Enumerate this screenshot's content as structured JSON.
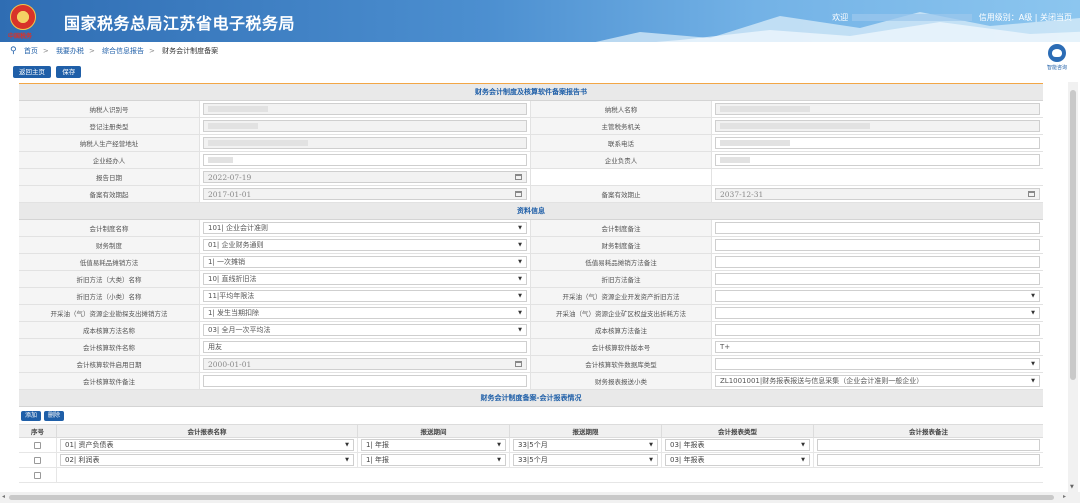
{
  "header": {
    "emblem_text": "中国税务",
    "title": "国家税务总局江苏省电子税务局",
    "welcome": "欢迎",
    "credit": "信用级别：A级",
    "close": "关闭当页"
  },
  "breadcrumb": {
    "items": [
      "首页",
      "我要办税",
      "综合信息报告",
      "财务会计制度备案"
    ]
  },
  "toolbar": {
    "back": "返回主页",
    "save": "保存"
  },
  "assistant": {
    "label": "智能咨询"
  },
  "sections": {
    "main": "财务会计制度及核算软件备案报告书",
    "info": "资料信息",
    "report": "财务会计制度备案-会计报表情况"
  },
  "basic": {
    "taxpayer_id_label": "纳税人识别号",
    "taxpayer_name_label": "纳税人名称",
    "reg_type_label": "登记注册类型",
    "tax_office_label": "主管税务机关",
    "address_label": "纳税人生产经营地址",
    "phone_label": "联系电话",
    "agent_label": "企业经办人",
    "responsible_label": "企业负责人",
    "report_date_label": "报告日期",
    "report_date": "2022-07-19",
    "valid_from_label": "备案有效期起",
    "valid_from": "2017-01-01",
    "valid_to_label": "备案有效期止",
    "valid_to": "2037-12-31"
  },
  "info": {
    "acct_system_name_label": "会计制度名称",
    "acct_system_name": "101| 企业会计准则",
    "acct_system_note_label": "会计制度备注",
    "fin_system_label": "财务制度",
    "fin_system": "01| 企业财务通则",
    "fin_system_note_label": "财务制度备注",
    "low_value_label": "低值易耗品摊销方法",
    "low_value": "1| 一次摊销",
    "low_value_note_label": "低值易耗品摊销方法备注",
    "dep_big_label": "折旧方法（大类）名称",
    "dep_big": "10| 直线折旧法",
    "dep_note_label": "折旧方法备注",
    "dep_small_label": "折旧方法（小类）名称",
    "dep_small": "11|平均年限法",
    "oil_dev_label": "开采油（气）资源企业开发资产折旧方法",
    "oil_exp_label": "开采油（气）资源企业勘探支出摊销方法",
    "oil_exp": "1| 发生当期扣除",
    "oil_mine_label": "开采油（气）资源企业矿区权益支出折耗方法",
    "cost_label": "成本核算方法名称",
    "cost": "03| 全月一次平均法",
    "cost_note_label": "成本核算方法备注",
    "soft_name_label": "会计核算软件名称",
    "soft_name": "用友",
    "soft_ver_label": "会计核算软件版本号",
    "soft_ver": "T+",
    "soft_date_label": "会计核算软件启用日期",
    "soft_date": "2000-01-01",
    "soft_db_label": "会计核算软件数据库类型",
    "soft_note_label": "会计核算软件备注",
    "fin_report_label": "财务报表报送小类",
    "fin_report": "ZL1001001|财务报表报送与信息采集（企业会计准则一般企业）"
  },
  "grid": {
    "add": "添加",
    "del": "删除",
    "headers": [
      "序号",
      "会计报表名称",
      "报送期间",
      "报送期限",
      "会计报表类型",
      "会计报表备注"
    ],
    "rows": [
      {
        "name": "01| 资产负债表",
        "period": "1| 年报",
        "deadline": "33|5个月",
        "type": "03| 年报表"
      },
      {
        "name": "02| 利润表",
        "period": "1| 年报",
        "deadline": "33|5个月",
        "type": "03| 年报表"
      }
    ]
  }
}
